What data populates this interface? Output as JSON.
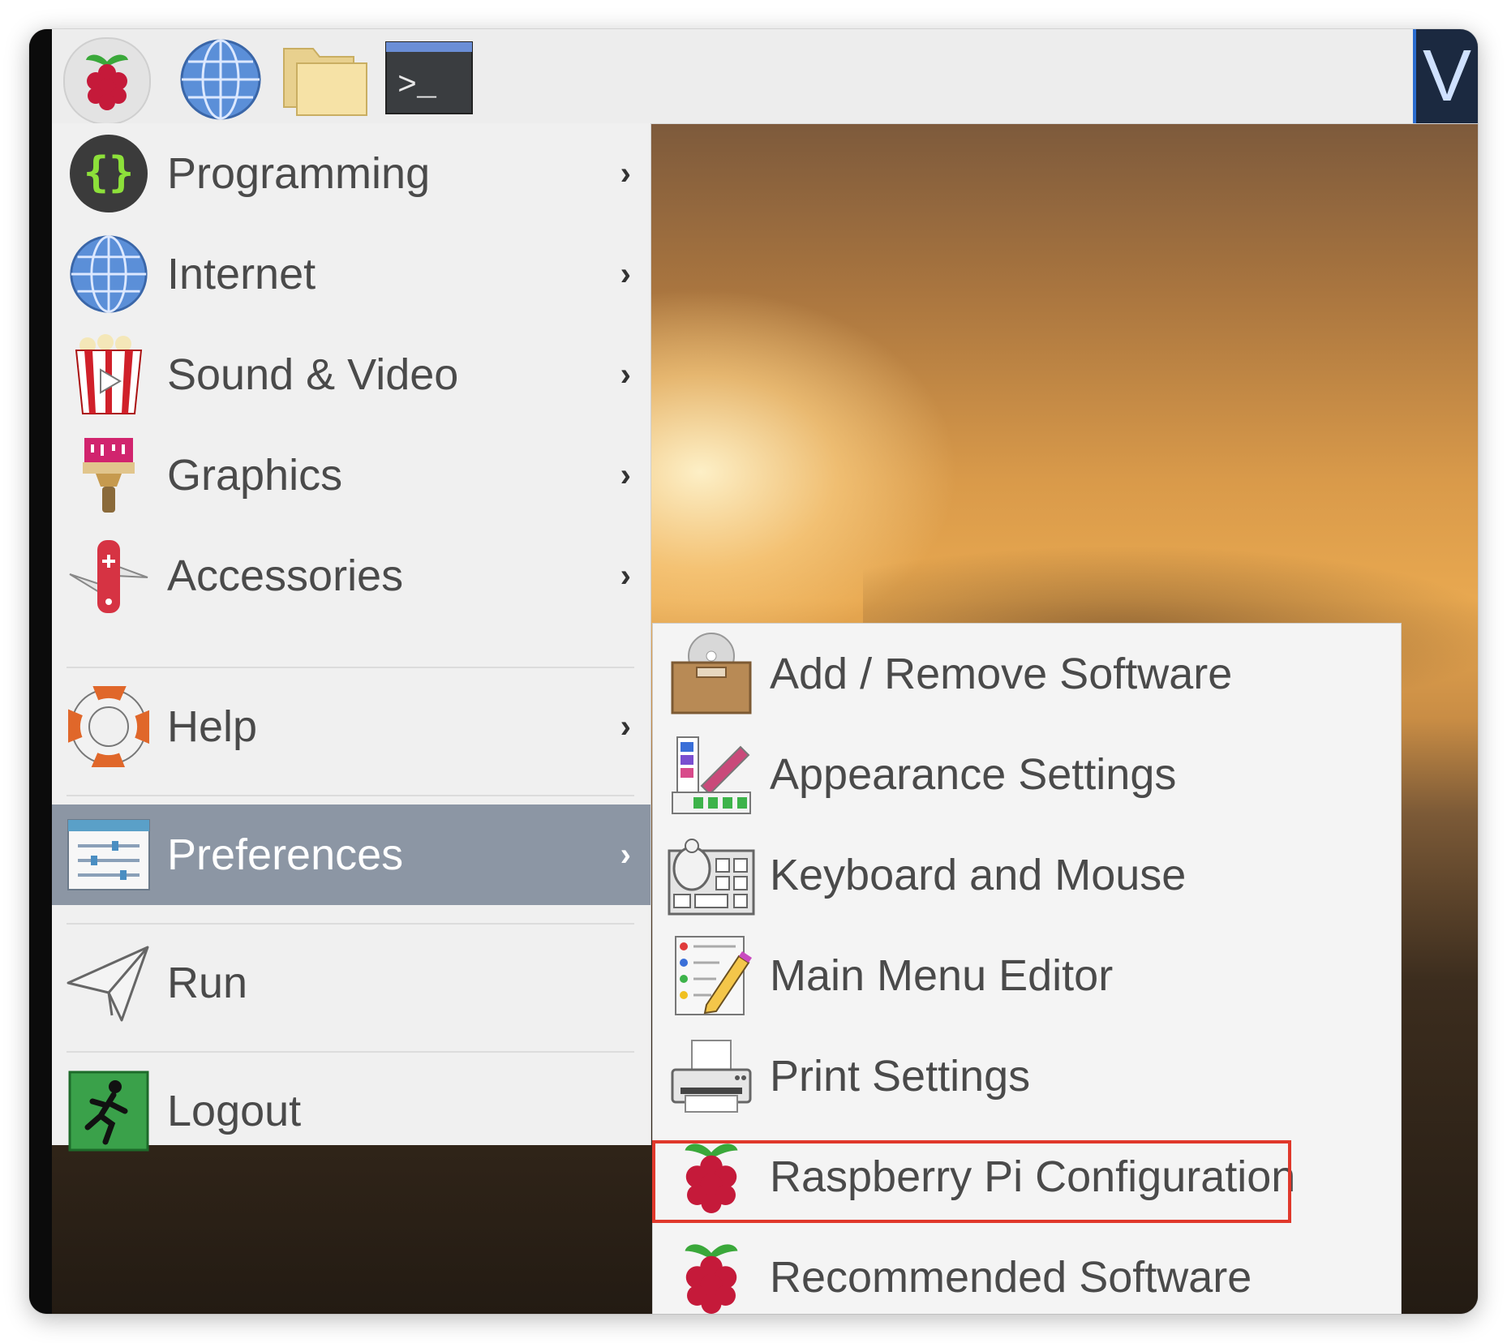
{
  "taskbar": {
    "launchers": [
      {
        "icon": "raspberry-menu-icon"
      },
      {
        "icon": "web-browser-globe-icon"
      },
      {
        "icon": "file-manager-folder-icon"
      },
      {
        "icon": "terminal-icon",
        "glyph": ">_"
      }
    ],
    "right_partial_text": "V"
  },
  "main_menu": {
    "items": [
      {
        "label": "Programming",
        "icon": "programming-braces-icon",
        "has_submenu": true
      },
      {
        "label": "Internet",
        "icon": "internet-globe-icon",
        "has_submenu": true
      },
      {
        "label": "Sound & Video",
        "icon": "sound-video-popcorn-icon",
        "has_submenu": true
      },
      {
        "label": "Graphics",
        "icon": "graphics-paintbrush-icon",
        "has_submenu": true
      },
      {
        "label": "Accessories",
        "icon": "accessories-knife-icon",
        "has_submenu": true
      },
      {
        "label": "Help",
        "icon": "help-lifebuoy-icon",
        "has_submenu": true
      },
      {
        "label": "Preferences",
        "icon": "preferences-sliders-icon",
        "has_submenu": true,
        "active": true
      },
      {
        "label": "Run",
        "icon": "run-paper-plane-icon",
        "has_submenu": false
      },
      {
        "label": "Logout",
        "icon": "logout-exit-icon",
        "has_submenu": false
      }
    ],
    "submenu_arrow": "›"
  },
  "preferences_submenu": {
    "items": [
      {
        "label": "Add / Remove Software",
        "icon": "package-box-icon"
      },
      {
        "label": "Appearance Settings",
        "icon": "appearance-palette-icon"
      },
      {
        "label": "Keyboard and Mouse",
        "icon": "keyboard-mouse-icon"
      },
      {
        "label": "Main Menu Editor",
        "icon": "menu-editor-pencil-icon"
      },
      {
        "label": "Print Settings",
        "icon": "printer-icon"
      },
      {
        "label": "Raspberry Pi Configuration",
        "icon": "raspberry-pi-icon",
        "highlighted": true
      },
      {
        "label": "Recommended Software",
        "icon": "raspberry-pi-icon"
      }
    ]
  },
  "colors": {
    "active_item_bg": "#8c96a4",
    "highlight_border": "#e0382b",
    "menu_bg": "#f0f0f0"
  }
}
